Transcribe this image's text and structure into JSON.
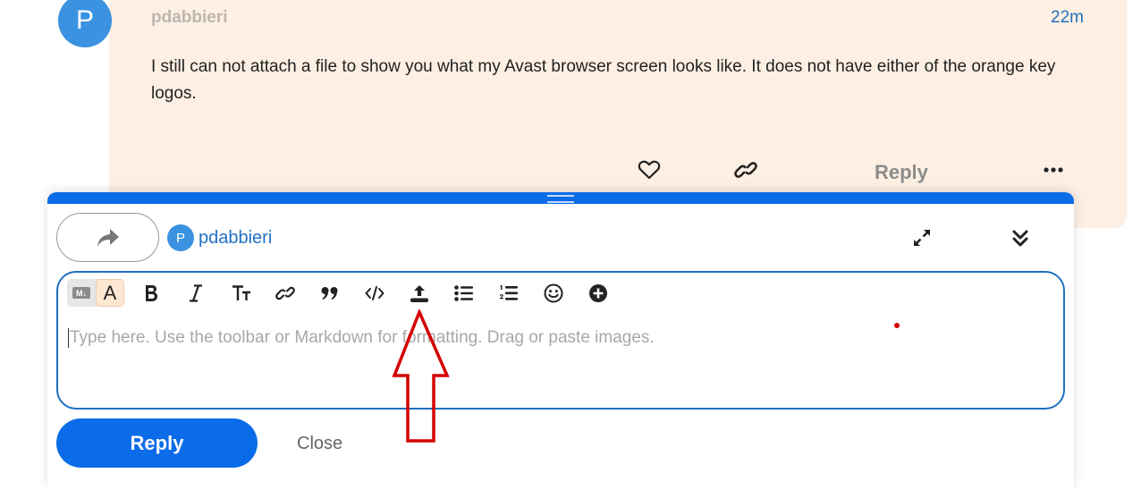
{
  "post": {
    "avatar_letter": "P",
    "username": "pdabbieri",
    "time": "22m",
    "body": "I still can not attach a file to show you what my Avast browser screen looks like. It does not have either of the orange key logos.",
    "actions": {
      "like_icon": "heart-icon",
      "link_icon": "link-icon",
      "reply_label": "Reply",
      "more_icon": "ellipsis-icon"
    }
  },
  "composer": {
    "accent": "#0a6ce8",
    "action_icon": "share-arrow-icon",
    "reply_to": {
      "avatar_letter": "P",
      "username": "pdabbieri"
    },
    "expand_icon": "expand-icon",
    "collapse_icon": "double-chevron-down-icon",
    "toolbar": {
      "markdown_badge": "M↓",
      "rich_text_letter": "A",
      "buttons": [
        "bold",
        "italic",
        "heading",
        "link",
        "blockquote",
        "code",
        "upload",
        "bullet-list",
        "numbered-list",
        "emoji",
        "insert"
      ]
    },
    "editor": {
      "placeholder": "Type here. Use the toolbar or Markdown for formatting. Drag or paste images."
    },
    "reply_label": "Reply",
    "close_label": "Close"
  },
  "annotation": {
    "arrow_color": "#d40000"
  }
}
